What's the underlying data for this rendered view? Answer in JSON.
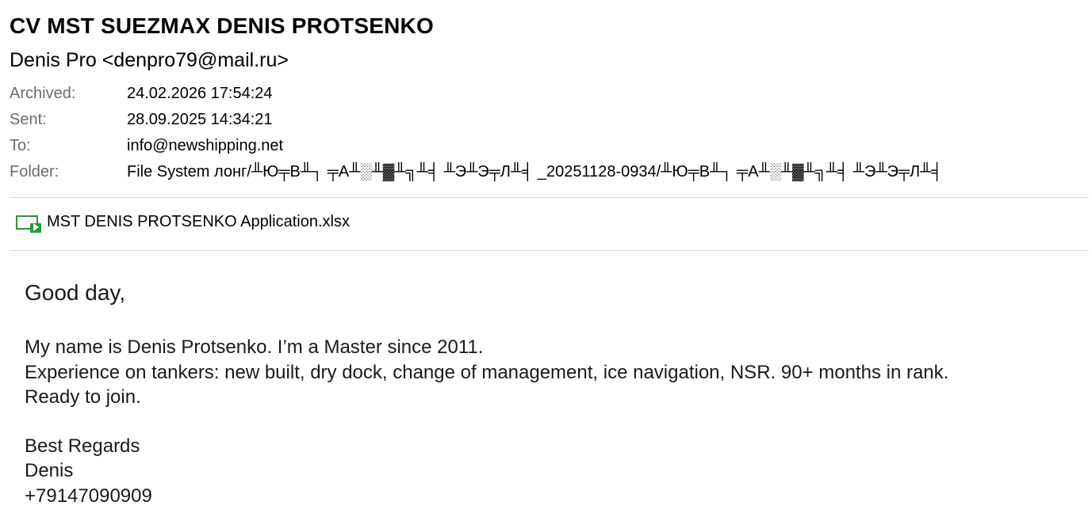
{
  "email": {
    "subject": "CV MST SUEZMAX DENIS PROTSENKO",
    "from": "Denis Pro <denpro79@mail.ru>",
    "meta": [
      {
        "label": "Archived:",
        "value": "24.02.2026 17:54:24"
      },
      {
        "label": "Sent:",
        "value": "28.09.2025 14:34:21"
      },
      {
        "label": "To:",
        "value": "info@newshipping.net"
      },
      {
        "label": "Folder:",
        "value": "File System лонг/╨Ю╤В╨┐ ╤А╨░╨▓╨╗╨╡ ╨Э╨Э╤Л╨╡ _20251128-0934/╨Ю╤В╨┐ ╤А╨░╨▓╨╗╨╡ ╨Э╨Э╤Л╨╡"
      }
    ],
    "attachment": {
      "name": "MST DENIS PROTSENKO Application.xlsx",
      "icon": "excel-file-icon"
    },
    "body": {
      "greeting": "Good day,",
      "paragraph": [
        "My name is Denis Protsenko. I’m a Master since 2011.",
        "Experience on tankers: new built, dry dock, change of management, ice navigation, NSR. 90+ months in rank.",
        "Ready to join."
      ],
      "signature": [
        "Best Regards",
        "Denis",
        "+79147090909"
      ]
    }
  },
  "colors": {
    "label_gray": "#6b6b6b",
    "divider": "#d9d9d9",
    "excel_green": "#1f9d3a"
  }
}
